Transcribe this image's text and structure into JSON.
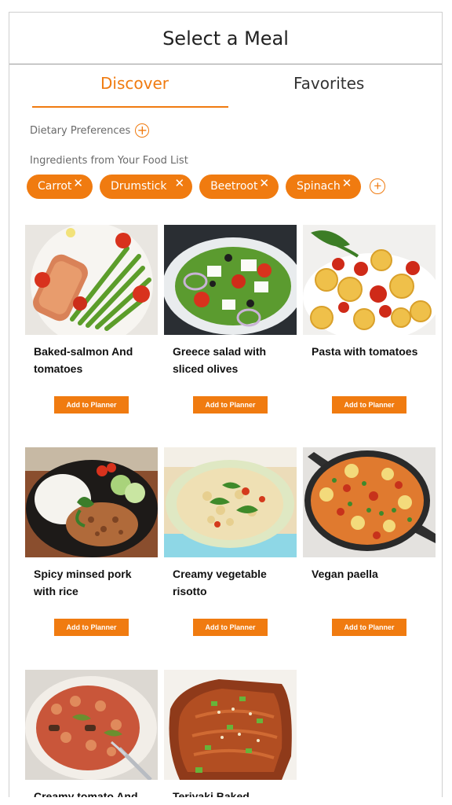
{
  "header": {
    "title": "Select a Meal"
  },
  "tabs": [
    {
      "label": "Discover",
      "active": true
    },
    {
      "label": "Favorites",
      "active": false
    }
  ],
  "preferences": {
    "dietary_label": "Dietary Preferences",
    "ingredients_label": "Ingredients from Your Food List"
  },
  "chips": [
    {
      "label": "Carrot",
      "remove_icon": "close-icon"
    },
    {
      "label": "Drumstick",
      "remove_icon": "close-icon"
    },
    {
      "label": "Beetroot",
      "remove_icon": "close-icon"
    },
    {
      "label": "Spinach",
      "remove_icon": "close-icon"
    }
  ],
  "meals": [
    {
      "name": "Baked-salmon And tomatoes",
      "button": "Add to Planner"
    },
    {
      "name": "Greece salad with sliced olives",
      "button": "Add to Planner"
    },
    {
      "name": "Pasta with tomatoes",
      "button": "Add to Planner"
    },
    {
      "name": "Spicy minsed pork with rice",
      "button": "Add to Planner"
    },
    {
      "name": "Creamy vegetable risotto",
      "button": "Add to Planner"
    },
    {
      "name": "Vegan paella",
      "button": "Add to Planner"
    },
    {
      "name": "Creamy tomato And",
      "button": ""
    },
    {
      "name": "Teriyaki Baked",
      "button": ""
    }
  ],
  "colors": {
    "accent": "#f07b10",
    "text": "#222222",
    "muted": "#6a6a6a"
  }
}
